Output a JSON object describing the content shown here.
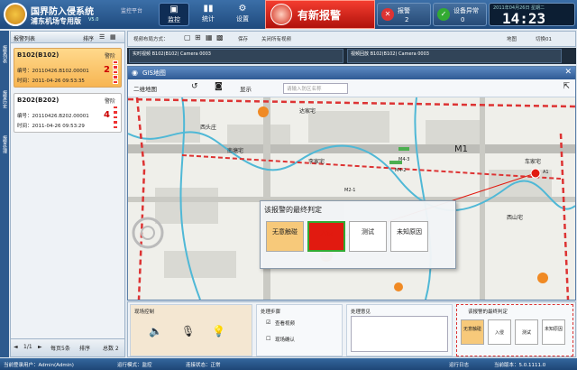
{
  "header": {
    "title": "国界防入侵系统",
    "subtitle": "浦东机场专用版",
    "version": "V5.0",
    "platform": "监控平台",
    "nav": [
      {
        "label": "监控",
        "icon": "monitor-icon"
      },
      {
        "label": "统计",
        "icon": "bar-chart-icon"
      },
      {
        "label": "设置",
        "icon": "gear-icon"
      }
    ],
    "alarm_banner": "有新报警",
    "counters": [
      {
        "label": "报警",
        "value": "2"
      },
      {
        "label": "设备异常",
        "value": "0"
      }
    ],
    "date": "2011年04月26日 星期二",
    "time": "14:23"
  },
  "left_tabs": [
    "报警列表",
    "报警历史",
    "报警处理"
  ],
  "alarm_list": {
    "title": "报警列表",
    "sort_label": "排序",
    "items": [
      {
        "name": "B102(B102)",
        "status": "警阶",
        "id_line": "编号：20110426.B102.00001",
        "time_line": "时间：2011-04-26 09:53:35",
        "count": "2"
      },
      {
        "name": "B202(B202)",
        "status": "警阶",
        "id_line": "编号：20110426.B202.00001",
        "time_line": "时间：2011-04-26 09:53:29",
        "count": "4"
      }
    ],
    "pager": "1/1",
    "per_page": "每页5条",
    "sort": "排序",
    "total": "总数 2"
  },
  "video_toolbar": {
    "layout": "视频布局方式：",
    "save": "保存",
    "close_all": "关闭所有视频",
    "tree": "地图",
    "switch": "切换01"
  },
  "video_tiles": [
    {
      "label": "实时视频 B102(B102) Camera 0003"
    },
    {
      "label": "视频回放 B102(B102) Camera 0003"
    }
  ],
  "gis": {
    "title": "GIS地图",
    "map_mode": "二维地图",
    "display": "显示",
    "search_placeholder": "请输入防区名称",
    "labels": [
      "达家宅",
      "西头庄",
      "南塘宅",
      "M1",
      "车家宅",
      "李家宅",
      "西山宅",
      "M4-3",
      "M4-2",
      "M2-1",
      "A1"
    ]
  },
  "judge_dialog": {
    "title": "该报警的最终判定",
    "buttons": [
      {
        "label": "无意触碰",
        "color": "#f7c97a"
      },
      {
        "label": "入侵",
        "color": "#e11a10"
      },
      {
        "label": "测试",
        "color": "#ffffff"
      },
      {
        "label": "未知原因",
        "color": "#ffffff"
      }
    ]
  },
  "bottom": {
    "scene_control": "现场控制",
    "process_steps": "处理步骤",
    "view_video": "查看视频",
    "scene_confirm": "现场确认",
    "process_opinion": "处理意见",
    "final_judge": "该报警的最终判定",
    "mini_buttons": [
      "无意触碰",
      "入侵",
      "测试",
      "未知原因"
    ]
  },
  "status_bar": {
    "user": "当前登录用户：Admin(Admin)",
    "mode": "运行模式：监控",
    "conn": "连接状态：正常",
    "log": "运行日志",
    "version": "当前版本：5.0.1111.0"
  }
}
